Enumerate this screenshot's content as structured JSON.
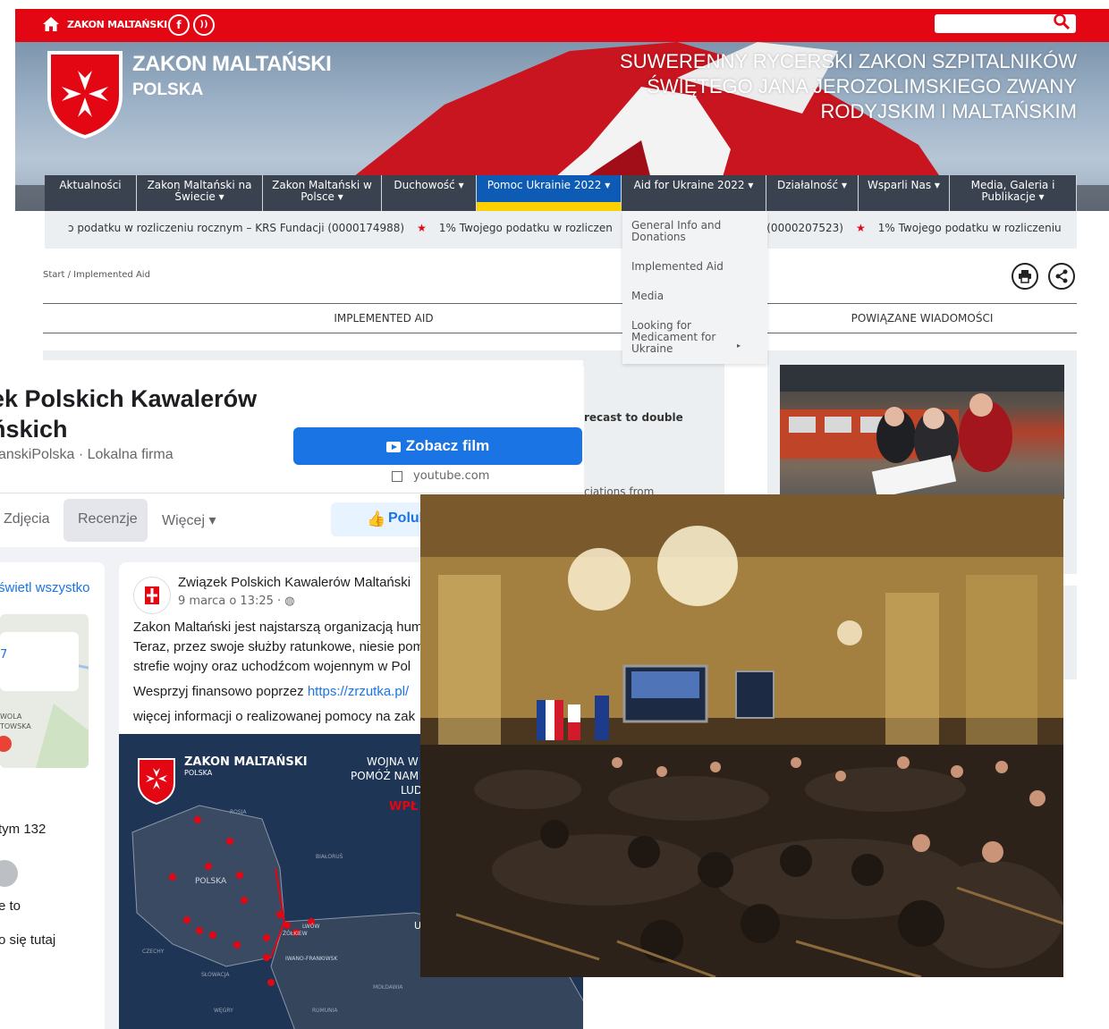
{
  "topbar": {
    "brand": "ZAKON MALTAŃSKI",
    "social": [
      "facebook-icon",
      "rss-icon"
    ],
    "search_placeholder": ""
  },
  "banner": {
    "title": "ZAKON MALTAŃSKI",
    "subtitle": "POLSKA",
    "slogan_lines": [
      "SUWERENNY RYCERSKI ZAKON SZPITALNIKÓW",
      "ŚWIĘTEGO JANA JEROZOLIMSKIEGO ZWANY",
      "RODYJSKIM I MALTAŃSKIM"
    ]
  },
  "nav": [
    {
      "label": "Aktualności"
    },
    {
      "label": "Zakon Maltański na Świecie ▾"
    },
    {
      "label": "Zakon Maltański w Polsce ▾"
    },
    {
      "label": "Duchowość ▾"
    },
    {
      "label": "Pomoc Ukrainie 2022 ▾"
    },
    {
      "label": "Aid for Ukraine 2022 ▾"
    },
    {
      "label": "Działalność ▾"
    },
    {
      "label": "Wsparli Nas ▾"
    },
    {
      "label": "Media, Galeria i Publikacje ▾"
    }
  ],
  "ticker": {
    "items": [
      "ɔ podatku w rozliczeniu rocznym – KRS Fundacji (0000174988)",
      "1% Twojego podatku w rozliczen",
      "acji (0000207523)",
      "1% Twojego podatku w rozliczeniu"
    ]
  },
  "dropdown": [
    {
      "label": "General Info and Donations"
    },
    {
      "label": "Implemented Aid"
    },
    {
      "label": "Media"
    },
    {
      "label": "Looking for Medicament for Ukraine"
    }
  ],
  "breadcrumb": "Start / Implemented Aid",
  "section_left": "IMPLEMENTED AID",
  "section_right": "POWIĄZANE WIADOMOŚCI",
  "snippets": [
    "recast to double",
    "ciations from"
  ],
  "facebook": {
    "page_title_1": "ek Polskich Kawalerów",
    "page_title_2": "ńskich",
    "meta": "ltanskiPolska · Lokalna firma",
    "watch_button": "Zobacz film",
    "link_domain": "youtube.com",
    "tabs": [
      "Zdjęcia",
      "Recenzje",
      "Więcej ▾"
    ],
    "like_button": "Polub",
    "left_link": "świetl wszystko",
    "left_map_labels": [
      "WOLA",
      "TOWSKA"
    ],
    "left_texts": [
      "tym 132",
      "e to",
      "o się tutaj"
    ],
    "post_author": "Związek Polskich Kawalerów Maltański",
    "post_date": "9 marca o 13:25 ·",
    "post_lines": [
      "Zakon Maltański jest najstarszą organizacją hum",
      "Teraz, przez swoje służby ratunkowe, niesie pom",
      "strefie wojny oraz uchodźcom wojennym w Pol"
    ],
    "post_donate_prefix": "Wesprzyj finansowo poprzez ",
    "post_donate_link": "https://zrzutka.pl/",
    "post_info": "więcej informacji o realizowanej pomocy na zak",
    "map": {
      "brand": "ZAKON MALTAŃSKI",
      "brand_sub": "POLSKA",
      "headline_1": "WOJNA W",
      "headline_2": "POMÓŻ NAM",
      "headline_3": "LUD",
      "headline_4": "WPŁ",
      "labels": [
        "ROSJA",
        "BIAŁORUŚ",
        "POLSKA",
        "CZECHY",
        "SŁOWACJA",
        "WĘGRY",
        "RUMUNIA",
        "MOŁDAWIA",
        "LWÓW",
        "ŻÓŁKIEW",
        "IWANO-FRANKIWSK",
        "U"
      ]
    }
  }
}
